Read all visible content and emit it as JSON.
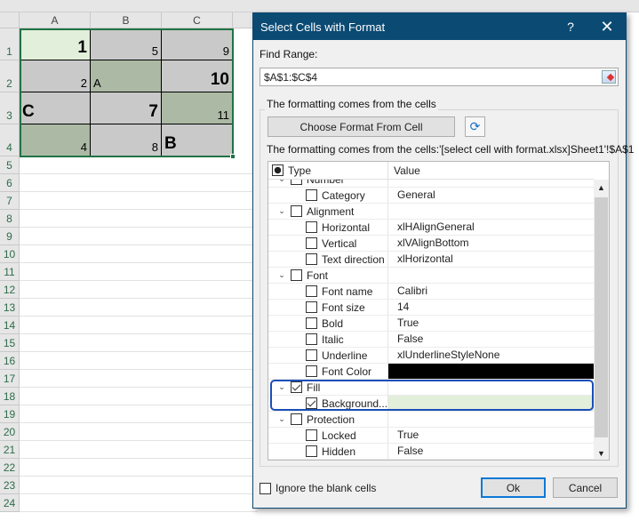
{
  "sheet": {
    "columns": [
      "A",
      "B",
      "C"
    ],
    "rows": [
      "1",
      "2",
      "3",
      "4",
      "5",
      "6",
      "7",
      "8",
      "9",
      "10",
      "11",
      "12",
      "13",
      "14",
      "15",
      "16",
      "17",
      "18",
      "19",
      "20",
      "21",
      "22",
      "23",
      "24"
    ],
    "cells": [
      {
        "v": "1",
        "fill": "#e2efda",
        "align": "r",
        "big": true
      },
      {
        "v": "5",
        "fill": "#c9c9c9",
        "align": "r"
      },
      {
        "v": "9",
        "fill": "#c9c9c9",
        "align": "r"
      },
      {
        "v": "2",
        "fill": "#c9c9c9",
        "align": "r"
      },
      {
        "v": "A",
        "fill": "#acb9a5",
        "align": "l"
      },
      {
        "v": "10",
        "fill": "#c9c9c9",
        "align": "r",
        "big": true
      },
      {
        "v": "C",
        "fill": "#c9c9c9",
        "align": "l",
        "big": true
      },
      {
        "v": "7",
        "fill": "#c9c9c9",
        "align": "r",
        "big": true
      },
      {
        "v": "11",
        "fill": "#acb9a5",
        "align": "r"
      },
      {
        "v": "4",
        "fill": "#acb9a5",
        "align": "r"
      },
      {
        "v": "8",
        "fill": "#c9c9c9",
        "align": "r"
      },
      {
        "v": "B",
        "fill": "#c9c9c9",
        "align": "l",
        "big": true
      }
    ]
  },
  "dialog": {
    "title": "Select Cells with Format",
    "help": "?",
    "close": "✕",
    "find_range_label": "Find Range:",
    "find_range_value": "$A$1:$C$4",
    "group_label": "The formatting comes from the cells",
    "choose_button": "Choose Format From Cell",
    "source_text": "The formatting comes from the cells:'[select cell with format.xlsx]Sheet1'!$A$1",
    "tree_header": {
      "type": "Type",
      "value": "Value"
    },
    "tree_rows": [
      {
        "label": "Number",
        "value": "",
        "level": 0,
        "checked": false
      },
      {
        "label": "Category",
        "value": "General",
        "level": 1,
        "checked": false
      },
      {
        "label": "Alignment",
        "value": "",
        "level": 0,
        "checked": false
      },
      {
        "label": "Horizontal",
        "value": "xlHAlignGeneral",
        "level": 1,
        "checked": false
      },
      {
        "label": "Vertical",
        "value": "xlVAlignBottom",
        "level": 1,
        "checked": false
      },
      {
        "label": "Text direction",
        "value": "xlHorizontal",
        "level": 1,
        "checked": false
      },
      {
        "label": "Font",
        "value": "",
        "level": 0,
        "checked": false
      },
      {
        "label": "Font name",
        "value": "Calibri",
        "level": 1,
        "checked": false
      },
      {
        "label": "Font size",
        "value": "14",
        "level": 1,
        "checked": false
      },
      {
        "label": "Bold",
        "value": "True",
        "level": 1,
        "checked": false
      },
      {
        "label": "Italic",
        "value": "False",
        "level": 1,
        "checked": false
      },
      {
        "label": "Underline",
        "value": "xlUnderlineStyleNone",
        "level": 1,
        "checked": false
      },
      {
        "label": "Font Color",
        "value": "",
        "level": 1,
        "checked": false,
        "swatch": "#000000"
      },
      {
        "label": "Fill",
        "value": "",
        "level": 0,
        "checked": true
      },
      {
        "label": "Background...",
        "value": "",
        "level": 1,
        "checked": true,
        "swatch": "#e2efda"
      },
      {
        "label": "Protection",
        "value": "",
        "level": 0,
        "checked": false
      },
      {
        "label": "Locked",
        "value": "True",
        "level": 1,
        "checked": false
      },
      {
        "label": "Hidden",
        "value": "False",
        "level": 1,
        "checked": false
      }
    ],
    "ignore_blank_label": "Ignore the blank cells",
    "ok": "Ok",
    "cancel": "Cancel"
  }
}
